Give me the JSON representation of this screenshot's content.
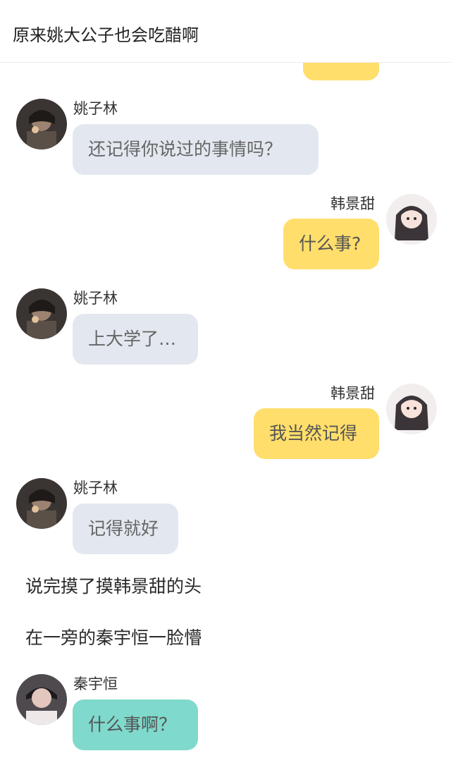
{
  "header": {
    "title": "原来姚大公子也会吃醋啊"
  },
  "colors": {
    "left_bubble": "#e3e8f0",
    "right_bubble": "#ffde6b",
    "teal_bubble": "#7fd9cc"
  },
  "messages": [
    {
      "speaker": "姚子林",
      "text": "还记得你说过的事情吗？",
      "side": "left",
      "avatar": "boy-avatar"
    },
    {
      "speaker": "韩景甜",
      "text": "什么事?",
      "side": "right",
      "avatar": "girl-avatar"
    },
    {
      "speaker": "姚子林",
      "text": "上大学了…",
      "side": "left",
      "avatar": "boy-avatar"
    },
    {
      "speaker": "韩景甜",
      "text": "我当然记得",
      "side": "right",
      "avatar": "girl-avatar"
    },
    {
      "speaker": "姚子林",
      "text": "记得就好",
      "side": "left",
      "avatar": "boy-avatar"
    },
    {
      "speaker": "秦宇恒",
      "text": "什么事啊？",
      "side": "left",
      "avatar": "boy2-avatar"
    }
  ],
  "narration": [
    "说完摸了摸韩景甜的头",
    "在一旁的秦宇恒一脸懵"
  ]
}
